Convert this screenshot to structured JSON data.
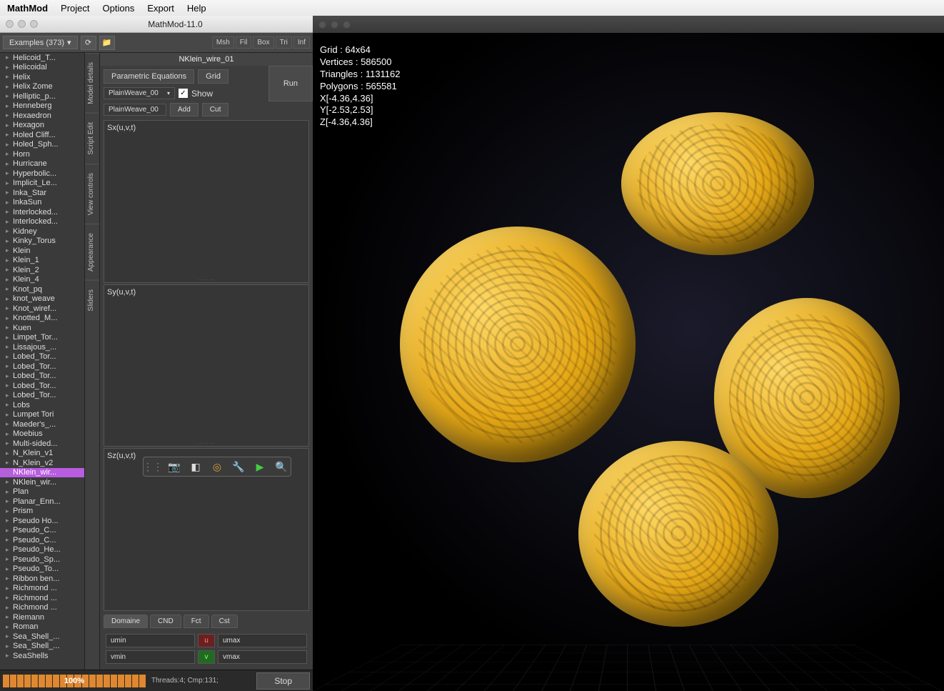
{
  "menubar": {
    "app": "MathMod",
    "items": [
      "Project",
      "Options",
      "Export",
      "Help"
    ]
  },
  "window": {
    "title": "MathMod-11.0"
  },
  "toolbar": {
    "examples_label": "Examples (373)",
    "mini_buttons": [
      "Msh",
      "Fil",
      "Box",
      "Tri",
      "Inf"
    ]
  },
  "tree_items": [
    "Helicoid_T...",
    "Helicoidal",
    "Helix",
    "Helix Zome",
    "Helliptic_p...",
    "Henneberg",
    "Hexaedron",
    "Hexagon",
    "Holed Cliff...",
    "Holed_Sph...",
    "Horn",
    "Hurricane",
    "Hyperbolic...",
    "Implicit_Le...",
    "Inka_Star",
    "InkaSun",
    "Interlocked...",
    "Interlocked...",
    "Kidney",
    "Kinky_Torus",
    "Klein",
    "Klein_1",
    "Klein_2",
    "Klein_4",
    "Knot_pq",
    "knot_weave",
    "Knot_wiref...",
    "Knotted_M...",
    "Kuen",
    "Limpet_Tor...",
    "Lissajous_...",
    "Lobed_Tor...",
    "Lobed_Tor...",
    "Lobed_Tor...",
    "Lobed_Tor...",
    "Lobed_Tor...",
    "Lobs",
    "Lumpet Tori",
    "Maeder's_...",
    "Moebius",
    "Multi-sided...",
    "N_Klein_v1",
    "N_Klein_v2",
    "NKlein_wir...",
    "NKlein_wir...",
    "Plan",
    "Planar_Enn...",
    "Prism",
    "Pseudo Ho...",
    "Pseudo_C...",
    "Pseudo_C...",
    "Pseudo_He...",
    "Pseudo_Sp...",
    "Pseudo_To...",
    "Ribbon ben...",
    "Richmond ...",
    "Richmond ...",
    "Richmond ...",
    "Riemann",
    "Roman",
    "Sea_Shell_...",
    "Sea_Shell_...",
    "SeaShells"
  ],
  "tree_selected_index": 43,
  "side_tabs": [
    "Model details",
    "Script Edit",
    "View controls",
    "Appearance",
    "Sliders"
  ],
  "editor": {
    "model_title": "NKlein_wire_01",
    "tab_parametric": "Parametric Equations",
    "tab_grid": "Grid",
    "combo_value": "PlainWeave_00",
    "show_label": "Show",
    "edit_value": "PlainWeave_00",
    "add_label": "Add",
    "cut_label": "Cut",
    "run_label": "Run",
    "eq_sx": "Sx(u,v,t)",
    "eq_sy": "Sy(u,v,t)",
    "eq_sz": "Sz(u,v,t)",
    "bottom_tabs": [
      "Domaine",
      "CND",
      "Fct",
      "Cst"
    ],
    "umin": "umin",
    "umax": "umax",
    "vmin": "vmin",
    "vmax": "vmax",
    "mid_u": "u",
    "mid_v": "v"
  },
  "progress": {
    "percent": "100%",
    "status": "Threads:4; Cmp:131;",
    "stop": "Stop"
  },
  "render_info": {
    "grid": "Grid     : 64x64",
    "vertices": "Vertices : 586500",
    "triangles": "Triangles : 1131162",
    "polygons": "Polygons : 565581",
    "xrange": "X[-4.36,4.36]",
    "yrange": "Y[-2.53,2.53]",
    "zrange": "Z[-4.36,4.36]"
  }
}
